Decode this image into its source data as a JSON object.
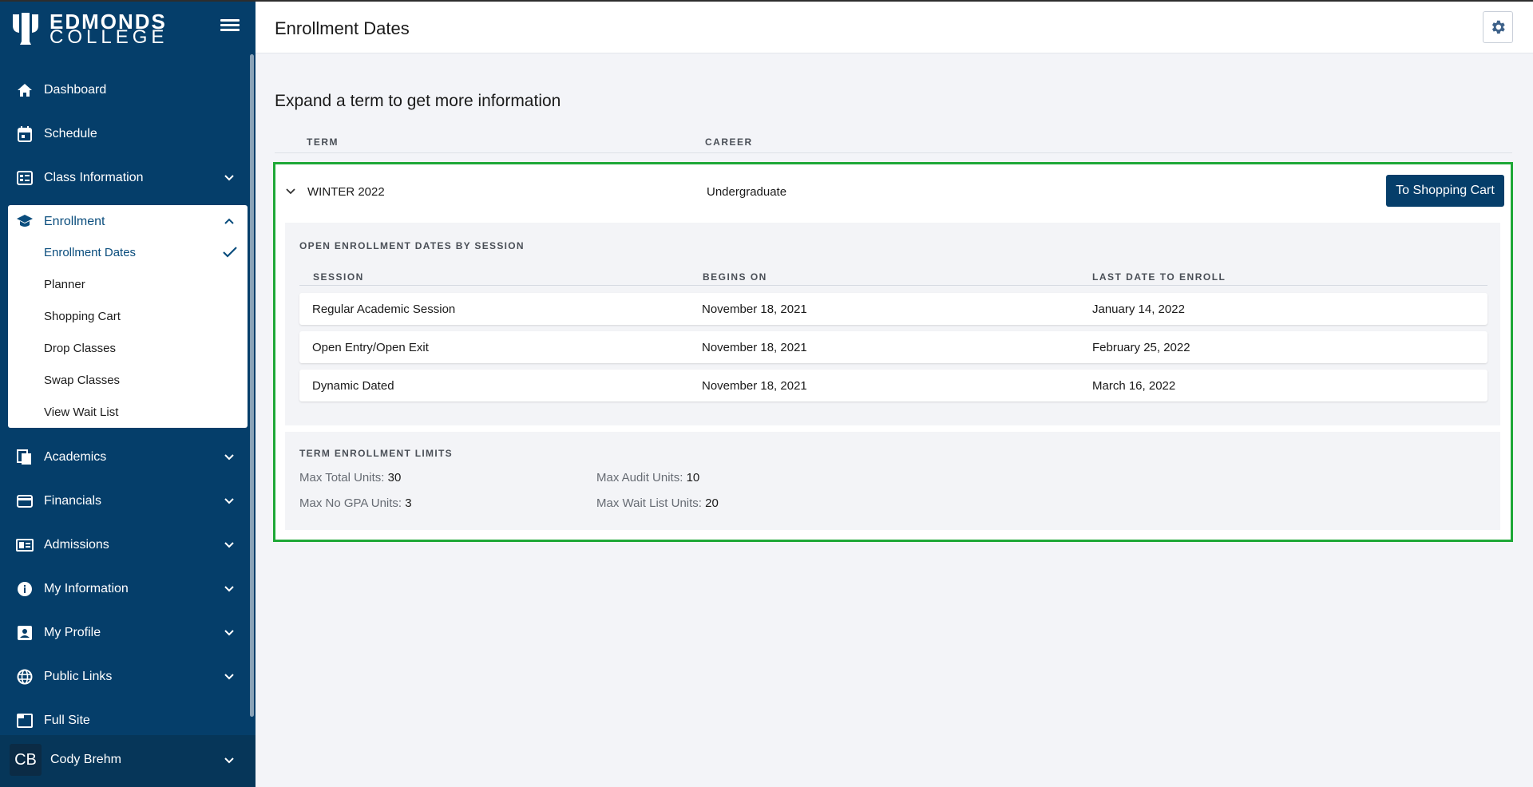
{
  "brand": {
    "line1": "EDMONDS",
    "line2": "COLLEGE"
  },
  "sidebar": {
    "items": [
      {
        "label": "Dashboard",
        "icon": "home-icon"
      },
      {
        "label": "Schedule",
        "icon": "calendar-icon"
      },
      {
        "label": "Class Information",
        "icon": "list-icon"
      },
      {
        "label": "Enrollment",
        "icon": "graduation-cap-icon"
      },
      {
        "label": "Academics",
        "icon": "documents-icon"
      },
      {
        "label": "Financials",
        "icon": "credit-card-icon"
      },
      {
        "label": "Admissions",
        "icon": "id-card-icon"
      },
      {
        "label": "My Information",
        "icon": "info-icon"
      },
      {
        "label": "My Profile",
        "icon": "profile-icon"
      },
      {
        "label": "Public Links",
        "icon": "globe-icon"
      },
      {
        "label": "Full Site",
        "icon": "window-icon"
      }
    ],
    "enrollment_sub": [
      {
        "label": "Enrollment Dates",
        "active": true
      },
      {
        "label": "Planner"
      },
      {
        "label": "Shopping Cart"
      },
      {
        "label": "Drop Classes"
      },
      {
        "label": "Swap Classes"
      },
      {
        "label": "View Wait List"
      }
    ],
    "user": {
      "initials": "CB",
      "name": "Cody Brehm"
    }
  },
  "header": {
    "title": "Enrollment Dates"
  },
  "main": {
    "instruction": "Expand a term to get more information",
    "columns": {
      "term": "TERM",
      "career": "CAREER"
    },
    "term": {
      "name": "WINTER 2022",
      "career": "Undergraduate",
      "cart_button": "To Shopping Cart",
      "sessions_title": "OPEN ENROLLMENT DATES BY SESSION",
      "session_columns": {
        "session": "SESSION",
        "begins": "BEGINS ON",
        "last": "LAST DATE TO ENROLL"
      },
      "sessions": [
        {
          "session": "Regular Academic Session",
          "begins": "November 18, 2021",
          "last": "January 14, 2022"
        },
        {
          "session": "Open Entry/Open Exit",
          "begins": "November 18, 2021",
          "last": "February 25, 2022"
        },
        {
          "session": "Dynamic Dated",
          "begins": "November 18, 2021",
          "last": "March 16, 2022"
        }
      ],
      "limits_title": "TERM ENROLLMENT LIMITS",
      "limits": {
        "max_total": {
          "label": "Max Total Units:",
          "value": "30"
        },
        "max_audit": {
          "label": "Max Audit Units:",
          "value": "10"
        },
        "max_no_gpa": {
          "label": "Max No GPA Units:",
          "value": "3"
        },
        "max_wait": {
          "label": "Max Wait List Units:",
          "value": "20"
        }
      }
    }
  },
  "colors": {
    "sidebar": "#053e6a",
    "accent": "#0a4d7d",
    "highlight": "#1ea837",
    "background": "#f3f4f8"
  }
}
